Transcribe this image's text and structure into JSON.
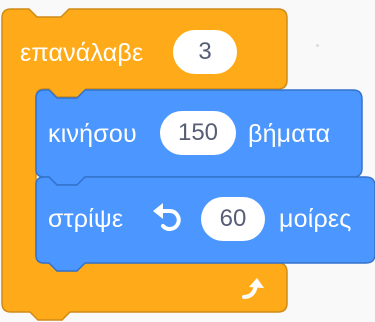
{
  "blocks": {
    "repeat": {
      "label": "επανάλαβε",
      "count": "3",
      "color": "#ffab19",
      "border_color": "#cf8b17",
      "arrow_icon": "loop-arrow-icon"
    },
    "move": {
      "label_before": "κινήσου",
      "steps": "150",
      "label_after": "βήματα",
      "color": "#4c97ff",
      "border_color": "#3373cc"
    },
    "turn": {
      "label_before": "στρίψε",
      "icon": "rotate-left-icon",
      "degrees": "60",
      "label_after": "μοίρες",
      "color": "#4c97ff",
      "border_color": "#3373cc"
    }
  }
}
